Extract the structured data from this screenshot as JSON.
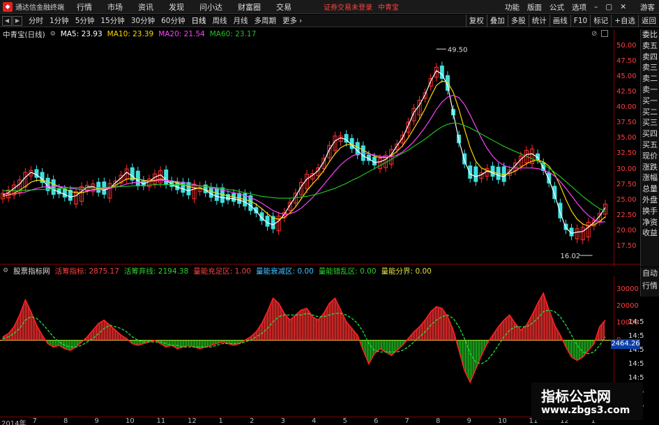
{
  "app": {
    "title": "通达信金融终端",
    "menu": [
      "行情",
      "市场",
      "资讯",
      "发现",
      "问小达",
      "财富圈",
      "交易"
    ],
    "warning": "证券交易未登录",
    "stock_link": "中青宝",
    "right_menu": [
      "功能",
      "版面",
      "公式",
      "选项",
      "游客"
    ]
  },
  "toolbar": {
    "periods": [
      "分时",
      "1分钟",
      "5分钟",
      "15分钟",
      "30分钟",
      "60分钟",
      "日线",
      "周线",
      "月线",
      "多周期",
      "更多"
    ],
    "active_period": "日线",
    "right_buttons": [
      "复权",
      "叠加",
      "多股",
      "统计",
      "画线",
      "F10",
      "标记",
      "+自选",
      "返回"
    ]
  },
  "price_header": {
    "name": "中青宝(日线)",
    "ma5": "MA5: 23.93",
    "ma10": "MA10: 23.39",
    "ma20": "MA20: 21.54",
    "ma60": "MA60: 23.17",
    "colors": {
      "ma5": "#ffffff",
      "ma10": "#ffd700",
      "ma20": "#ff40ff",
      "ma60": "#20c020"
    }
  },
  "side_tabs": [
    "委比",
    "卖五",
    "卖四",
    "卖三",
    "卖二",
    "卖一",
    "买一",
    "买二",
    "买三",
    "买四",
    "买五",
    "现价",
    "涨跌",
    "涨幅",
    "总量",
    "外盘",
    "换手",
    "净资",
    "收益"
  ],
  "side_tabs_lower": [
    "自动",
    "行情"
  ],
  "indicator_header": {
    "name": "股票指标网",
    "active_label": "活筹指标:",
    "active_value": "2875.17",
    "dead_label": "活筹弃线:",
    "dead_value": "2194.38",
    "f1_label": "量能充足区:",
    "f1_value": "1.00",
    "f2_label": "量能衰减区:",
    "f2_value": "0.00",
    "f3_label": "量能错乱区:",
    "f3_value": "0.00",
    "f4_label": "量能分界:",
    "f4_value": "0.00"
  },
  "price_tag": "2464.26",
  "dates": [
    "2014年",
    "7",
    "8",
    "9",
    "10",
    "11",
    "12",
    "1",
    "2",
    "3",
    "4",
    "5",
    "6",
    "7",
    "8",
    "9",
    "10",
    "11",
    "12",
    "1"
  ],
  "watermark": {
    "line1": "指标公式网",
    "line2": "www.zbgs3.com"
  },
  "chart_data": [
    {
      "type": "candlestick",
      "title": "中青宝(日线)",
      "ylim": [
        15,
        51
      ],
      "y_ticks": [
        50.0,
        47.5,
        45.0,
        42.5,
        40.0,
        37.5,
        35.0,
        32.5,
        30.0,
        27.5,
        25.0,
        22.5,
        20.0,
        17.5
      ],
      "annotations": [
        {
          "label": "49.50"
        },
        {
          "label": "16.02"
        }
      ],
      "series": [
        {
          "name": "MA5",
          "values": [
            25.8,
            26.2,
            26.9,
            27.6,
            28.7,
            29.5,
            29.1,
            28.4,
            27.2,
            26.7,
            26.3,
            25.9,
            25.5,
            25.7,
            26.4,
            27.1,
            27.2,
            26.8,
            26.6,
            26.9,
            27.8,
            28.6,
            29.5,
            28.9,
            28.1,
            27.6,
            28.0,
            28.7,
            29.1,
            28.3,
            27.5,
            27.1,
            26.8,
            26.5,
            26.8,
            27.0,
            26.6,
            26.0,
            25.6,
            25.4,
            25.3,
            25.2,
            25.0,
            24.7,
            24.1,
            23.2,
            22.1,
            21.3,
            21.0,
            21.6,
            22.7,
            24.2,
            25.6,
            27.2,
            28.4,
            29.0,
            29.8,
            31.2,
            33.2,
            34.6,
            35.1,
            34.8,
            33.9,
            33.0,
            32.2,
            31.7,
            31.1,
            31.2,
            31.6,
            32.4,
            33.8,
            35.1,
            37.1,
            39.2,
            40.4,
            42.1,
            44.3,
            46.0,
            45.4,
            43.6,
            39.1,
            34.7,
            31.4,
            29.2,
            28.8,
            29.1,
            29.7,
            29.4,
            29.0,
            28.8,
            29.6,
            30.6,
            31.6,
            32.4,
            32.5,
            31.9,
            30.2,
            28.3,
            25.9,
            22.9,
            20.5,
            19.6,
            19.8,
            19.9,
            20.6,
            21.4,
            22.4,
            23.8
          ]
        },
        {
          "name": "MA10",
          "values": [
            25.6,
            25.8,
            26.1,
            26.6,
            27.2,
            27.9,
            28.2,
            28.2,
            28.0,
            27.6,
            27.2,
            26.8,
            26.4,
            26.2,
            26.2,
            26.4,
            26.7,
            26.8,
            26.9,
            27.0,
            27.4,
            27.9,
            28.4,
            28.5,
            28.4,
            28.2,
            28.1,
            28.2,
            28.4,
            28.3,
            28.0,
            27.8,
            27.5,
            27.2,
            27.0,
            26.9,
            26.7,
            26.4,
            26.1,
            25.9,
            25.7,
            25.5,
            25.3,
            25.1,
            24.8,
            24.3,
            23.6,
            22.8,
            22.1,
            21.9,
            22.2,
            22.9,
            23.9,
            25.2,
            26.5,
            27.6,
            28.6,
            29.8,
            31.2,
            32.5,
            33.5,
            34.0,
            34.0,
            33.6,
            33.1,
            32.6,
            32.1,
            31.9,
            31.9,
            32.2,
            32.9,
            33.8,
            35.1,
            36.6,
            38.1,
            39.8,
            41.8,
            43.6,
            44.3,
            44.1,
            42.5,
            39.7,
            36.5,
            33.5,
            31.3,
            30.2,
            29.8,
            29.6,
            29.3,
            29.1,
            29.3,
            29.7,
            30.3,
            30.9,
            31.3,
            31.5,
            31.2,
            30.5,
            29.2,
            27.3,
            25.1,
            23.2,
            21.9,
            21.1,
            20.8,
            21.0,
            21.5,
            22.3
          ]
        },
        {
          "name": "MA20",
          "values": [
            26.0,
            26.0,
            26.0,
            26.1,
            26.3,
            26.6,
            26.9,
            27.1,
            27.2,
            27.2,
            27.2,
            27.1,
            26.9,
            26.8,
            26.7,
            26.6,
            26.6,
            26.7,
            26.8,
            26.9,
            27.1,
            27.3,
            27.6,
            27.8,
            27.9,
            28.0,
            28.0,
            28.1,
            28.2,
            28.2,
            28.1,
            28.0,
            27.8,
            27.7,
            27.5,
            27.3,
            27.2,
            27.0,
            26.8,
            26.6,
            26.4,
            26.2,
            26.0,
            25.7,
            25.4,
            25.0,
            24.5,
            23.9,
            23.3,
            22.9,
            22.7,
            22.8,
            23.1,
            23.7,
            24.5,
            25.4,
            26.4,
            27.5,
            28.6,
            29.7,
            30.7,
            31.5,
            32.1,
            32.5,
            32.6,
            32.5,
            32.3,
            32.1,
            32.0,
            32.0,
            32.3,
            32.8,
            33.6,
            34.5,
            35.6,
            36.8,
            38.2,
            39.7,
            40.9,
            41.7,
            42.0,
            41.6,
            40.5,
            38.8,
            36.9,
            35.0,
            33.4,
            32.1,
            31.2,
            30.6,
            30.3,
            30.2,
            30.2,
            30.2,
            30.2,
            30.1,
            29.9,
            29.5,
            28.9,
            28.0,
            26.9,
            25.7,
            24.5,
            23.4,
            22.5,
            21.8,
            21.4,
            21.5
          ]
        },
        {
          "name": "MA60",
          "values": [
            26.5,
            26.5,
            26.5,
            26.5,
            26.6,
            26.6,
            26.7,
            26.7,
            26.8,
            26.8,
            26.9,
            26.9,
            27.0,
            27.0,
            27.0,
            27.0,
            27.0,
            27.0,
            27.0,
            27.1,
            27.1,
            27.2,
            27.2,
            27.3,
            27.3,
            27.4,
            27.4,
            27.5,
            27.5,
            27.5,
            27.5,
            27.5,
            27.5,
            27.4,
            27.4,
            27.3,
            27.2,
            27.1,
            27.0,
            26.9,
            26.7,
            26.6,
            26.4,
            26.2,
            26.0,
            25.8,
            25.6,
            25.5,
            25.4,
            25.3,
            25.3,
            25.3,
            25.4,
            25.5,
            25.6,
            25.8,
            26.0,
            26.3,
            26.6,
            26.9,
            27.3,
            27.7,
            28.2,
            28.6,
            29.1,
            29.6,
            30.1,
            30.6,
            31.1,
            31.6,
            32.1,
            32.6,
            33.1,
            33.7,
            34.3,
            34.9,
            35.6,
            36.3,
            36.9,
            37.3,
            37.5,
            37.4,
            37.1,
            36.7,
            36.2,
            35.7,
            35.2,
            34.7,
            34.2,
            33.7,
            33.3,
            32.9,
            32.5,
            32.1,
            31.7,
            31.3,
            30.8,
            30.2,
            29.5,
            28.8,
            28.0,
            27.2,
            26.4,
            25.6,
            24.9,
            24.2,
            23.6,
            23.2
          ]
        }
      ]
    },
    {
      "type": "bar",
      "title": "股票指标网",
      "y_ticks": [
        30000,
        20000,
        10000,
        0
      ],
      "series": [
        {
          "name": "活筹指标",
          "values": [
            2000,
            4000,
            8000,
            15000,
            24000,
            17000,
            9000,
            3000,
            -2000,
            -4000,
            -3000,
            -5000,
            -6000,
            -4000,
            -1000,
            2000,
            6000,
            10000,
            12000,
            9000,
            6000,
            3000,
            1000,
            -2000,
            -3000,
            -2000,
            -1000,
            0,
            -2000,
            -4000,
            -3000,
            -5000,
            -4000,
            -3000,
            -4000,
            -5000,
            -4000,
            -3000,
            -2000,
            -1000,
            -2000,
            -3000,
            -2000,
            0,
            2000,
            5000,
            10000,
            17000,
            25000,
            22000,
            16000,
            12000,
            15000,
            18000,
            19000,
            14000,
            12000,
            16000,
            22000,
            25000,
            18000,
            11000,
            7000,
            3000,
            -6000,
            -14000,
            -8000,
            -5000,
            -7000,
            -9000,
            -6000,
            -3000,
            1000,
            5000,
            8000,
            12000,
            17000,
            20000,
            19000,
            14000,
            6000,
            -6000,
            -18000,
            -25000,
            -17000,
            -9000,
            -2000,
            3000,
            8000,
            12000,
            15000,
            10000,
            6000,
            9000,
            15000,
            22000,
            28000,
            18000,
            9000,
            3000,
            -4000,
            -10000,
            -12000,
            -10000,
            -6000,
            -2000,
            8000,
            12000
          ]
        },
        {
          "name": "活筹弃线",
          "values": [
            1000,
            2000,
            4000,
            7000,
            12000,
            14000,
            13000,
            10000,
            6000,
            2000,
            -1000,
            -3000,
            -4000,
            -4000,
            -3000,
            -1000,
            1000,
            4000,
            7000,
            9000,
            8000,
            7000,
            5000,
            2000,
            0,
            -1000,
            -1000,
            -1000,
            -1000,
            -2000,
            -3000,
            -3000,
            -4000,
            -4000,
            -4000,
            -4000,
            -4000,
            -4000,
            -3000,
            -2000,
            -2000,
            -2000,
            -2000,
            -1000,
            0,
            2000,
            4000,
            7000,
            11000,
            14000,
            15000,
            15000,
            15000,
            15000,
            16000,
            15000,
            14000,
            14000,
            15000,
            16000,
            16000,
            15000,
            13000,
            10000,
            5000,
            -2000,
            -6000,
            -7000,
            -7000,
            -7000,
            -7000,
            -6000,
            -4000,
            -1000,
            2000,
            5000,
            9000,
            12000,
            14000,
            15000,
            13000,
            8000,
            1000,
            -8000,
            -13000,
            -14000,
            -12000,
            -8000,
            -3000,
            2000,
            6000,
            8000,
            8000,
            8000,
            10000,
            13000,
            17000,
            18000,
            17000,
            14000,
            9000,
            3000,
            -3000,
            -7000,
            -8000,
            -7000,
            -3000,
            2000
          ]
        }
      ]
    }
  ]
}
